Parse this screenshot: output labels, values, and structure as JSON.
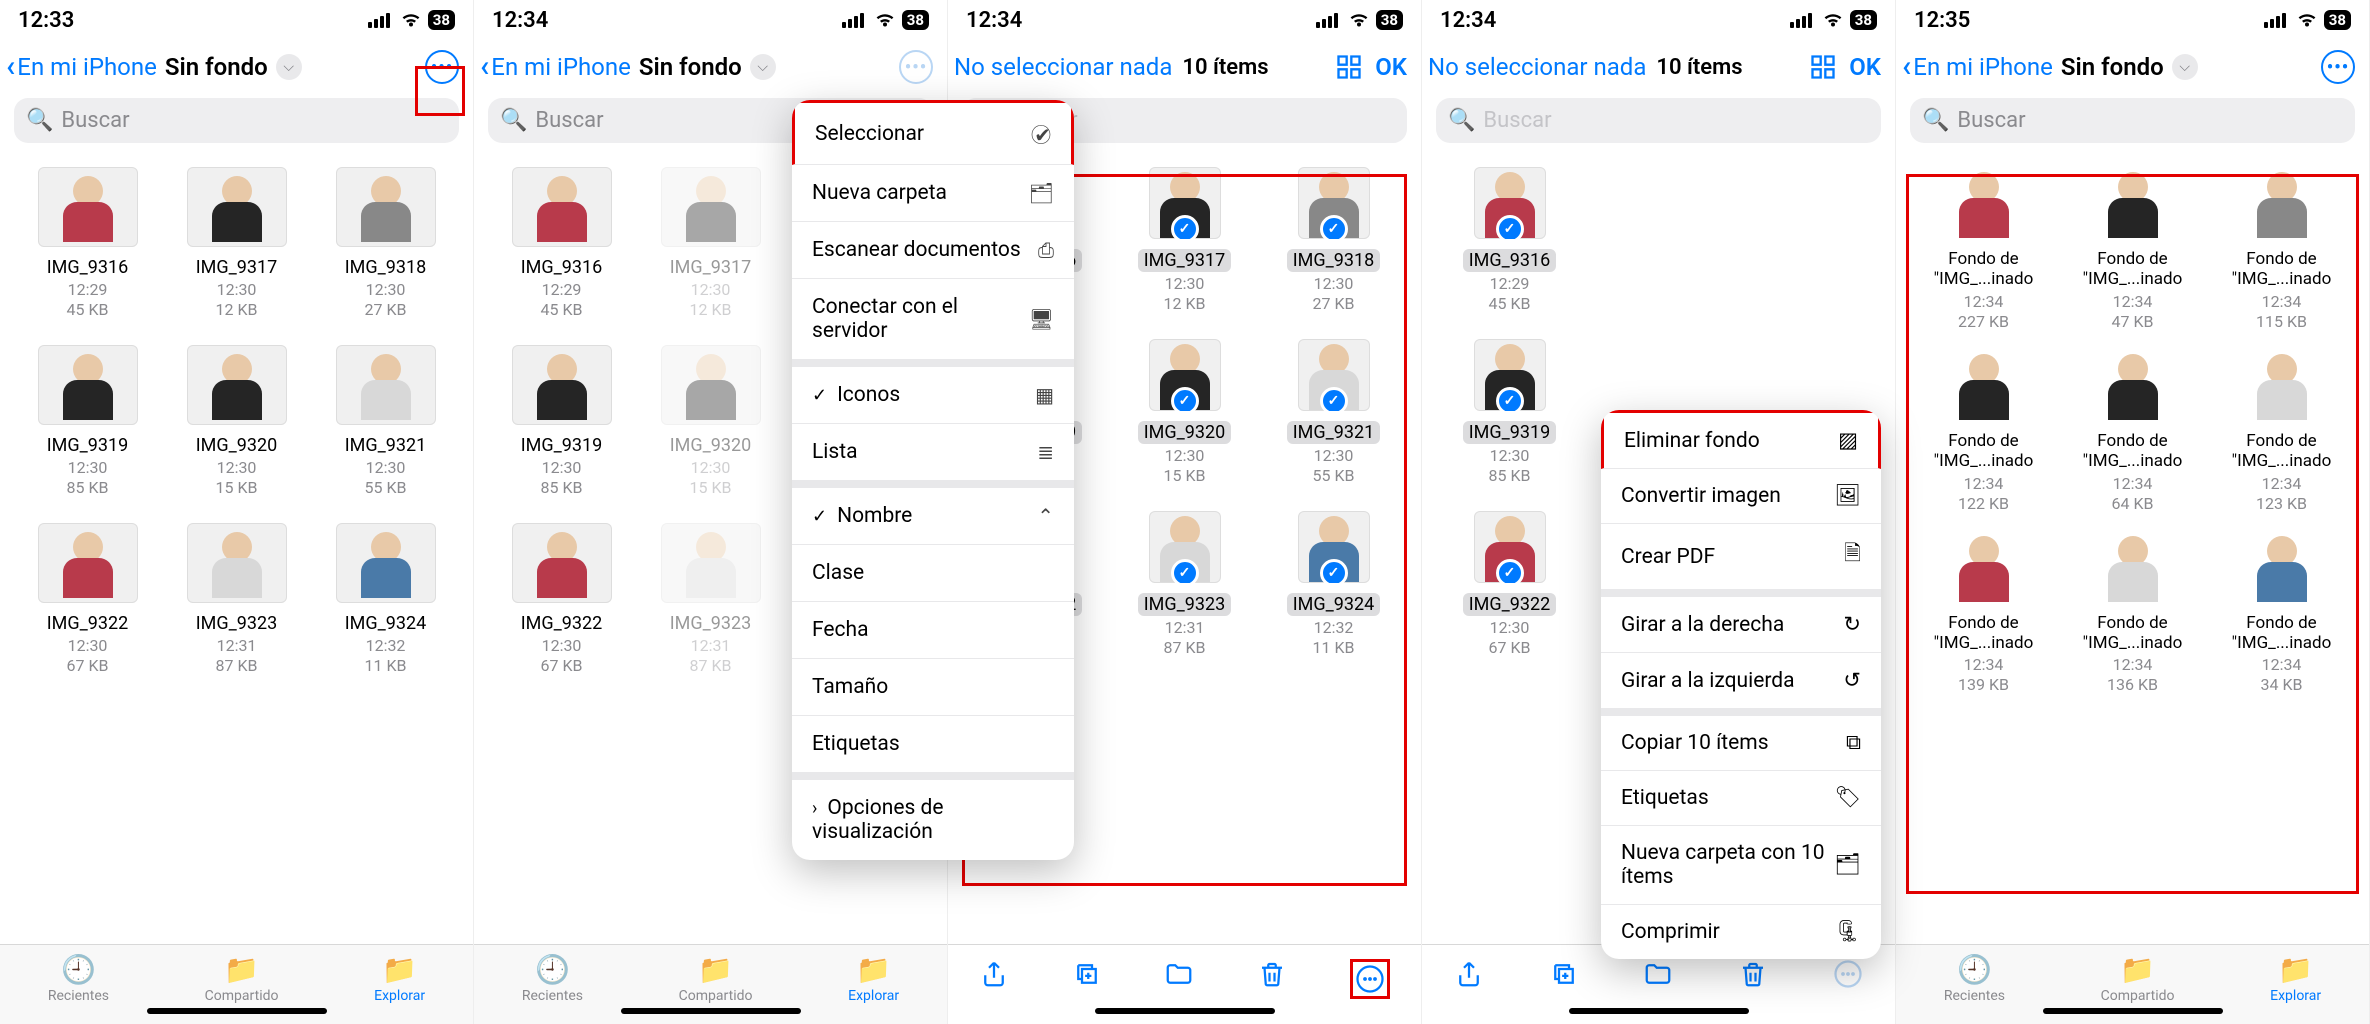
{
  "status": {
    "battery": "38"
  },
  "times": [
    "12:33",
    "12:34",
    "12:34",
    "12:34",
    "12:35"
  ],
  "back_label": "En mi iPhone",
  "folder": "Sin fondo",
  "search_placeholder": "Buscar",
  "deselect": "No seleccionar nada",
  "count": "10 ítems",
  "ok": "OK",
  "files": [
    {
      "n": "IMG_9316",
      "t": "12:29",
      "s": "45 KB",
      "c": "red"
    },
    {
      "n": "IMG_9317",
      "t": "12:30",
      "s": "12 KB",
      "c": "dark"
    },
    {
      "n": "IMG_9318",
      "t": "12:30",
      "s": "27 KB",
      "c": "gray"
    },
    {
      "n": "IMG_9319",
      "t": "12:30",
      "s": "85 KB",
      "c": "dark"
    },
    {
      "n": "IMG_9320",
      "t": "12:30",
      "s": "15 KB",
      "c": "dark"
    },
    {
      "n": "IMG_9321",
      "t": "12:30",
      "s": "55 KB",
      "c": "light"
    },
    {
      "n": "IMG_9322",
      "t": "12:30",
      "s": "67 KB",
      "c": "red"
    },
    {
      "n": "IMG_9323",
      "t": "12:31",
      "s": "87 KB",
      "c": "light"
    },
    {
      "n": "IMG_9324",
      "t": "12:32",
      "s": "11 KB",
      "c": "blue"
    }
  ],
  "files5": [
    {
      "n": "Fondo de \"IMG_...inado",
      "t": "12:34",
      "s": "227 KB",
      "c": "red"
    },
    {
      "n": "Fondo de \"IMG_...inado",
      "t": "12:34",
      "s": "47 KB",
      "c": "dark"
    },
    {
      "n": "Fondo de \"IMG_...inado",
      "t": "12:34",
      "s": "115 KB",
      "c": "gray"
    },
    {
      "n": "Fondo de \"IMG_...inado",
      "t": "12:34",
      "s": "122 KB",
      "c": "dark"
    },
    {
      "n": "Fondo de \"IMG_...inado",
      "t": "12:34",
      "s": "64 KB",
      "c": "dark"
    },
    {
      "n": "Fondo de \"IMG_...inado",
      "t": "12:34",
      "s": "123 KB",
      "c": "light"
    },
    {
      "n": "Fondo de \"IMG_...inado",
      "t": "12:34",
      "s": "139 KB",
      "c": "red"
    },
    {
      "n": "Fondo de \"IMG_...inado",
      "t": "12:34",
      "s": "136 KB",
      "c": "light"
    },
    {
      "n": "Fondo de \"IMG_...inado",
      "t": "12:34",
      "s": "34 KB",
      "c": "blue"
    }
  ],
  "tabs": {
    "recents": "Recientes",
    "shared": "Compartido",
    "browse": "Explorar"
  },
  "menu1": {
    "select": "Seleccionar",
    "newfolder": "Nueva carpeta",
    "scan": "Escanear documentos",
    "connect": "Conectar con el servidor",
    "icons": "Iconos",
    "list": "Lista",
    "name": "Nombre",
    "kind": "Clase",
    "date": "Fecha",
    "size": "Tamaño",
    "tags": "Etiquetas",
    "viewopts": "Opciones de visualización"
  },
  "menu2": {
    "removebg": "Eliminar fondo",
    "convert": "Convertir imagen",
    "pdf": "Crear PDF",
    "rotr": "Girar a la derecha",
    "rotl": "Girar a la izquierda",
    "copy": "Copiar 10 ítems",
    "tags": "Etiquetas",
    "newfolder": "Nueva carpeta con 10 ítems",
    "compress": "Comprimir"
  }
}
